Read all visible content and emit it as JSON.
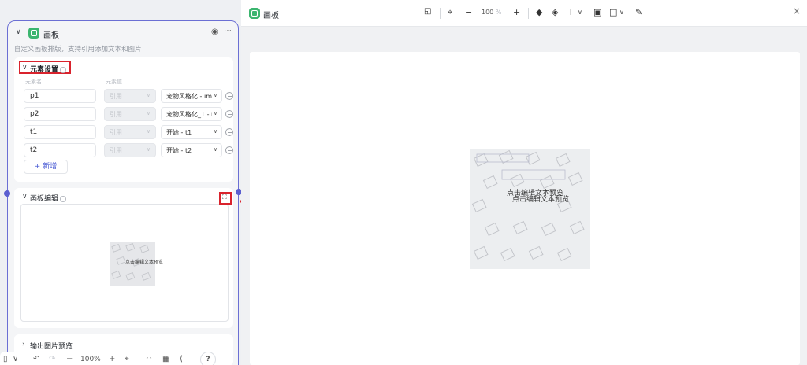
{
  "node": {
    "title": "画板",
    "description": "自定义画板排版，支持引用添加文本和图片",
    "element_settings": {
      "title": "元素设置",
      "col_name": "元素名",
      "col_value": "元素值",
      "rows": [
        {
          "name": "p1",
          "type": "引用",
          "value": "宠物风格化 - ima"
        },
        {
          "name": "p2",
          "type": "引用",
          "value": "宠物风格化_1 - i"
        },
        {
          "name": "t1",
          "type": "引用",
          "value": "开始 - t1"
        },
        {
          "name": "t2",
          "type": "引用",
          "value": "开始 - t2"
        }
      ],
      "add_label": "+ 新增"
    },
    "canvas_edit": {
      "title": "画板编辑",
      "preview_text": "点击编辑文本预览"
    },
    "output_preview": {
      "title": "输出图片预览"
    },
    "bottom_toolbar": {
      "zoom": "100%",
      "help": "?"
    }
  },
  "editor": {
    "title": "画板",
    "zoom_value": "100",
    "zoom_unit": "%",
    "canvas_text_1": "点击编辑文本预览",
    "canvas_text_2": "点击编辑文本预览"
  },
  "colors": {
    "node_border": "#6b6fd4",
    "highlight": "#d9232d",
    "app_icon": "#3bb56f",
    "link": "#4a5bd4"
  }
}
